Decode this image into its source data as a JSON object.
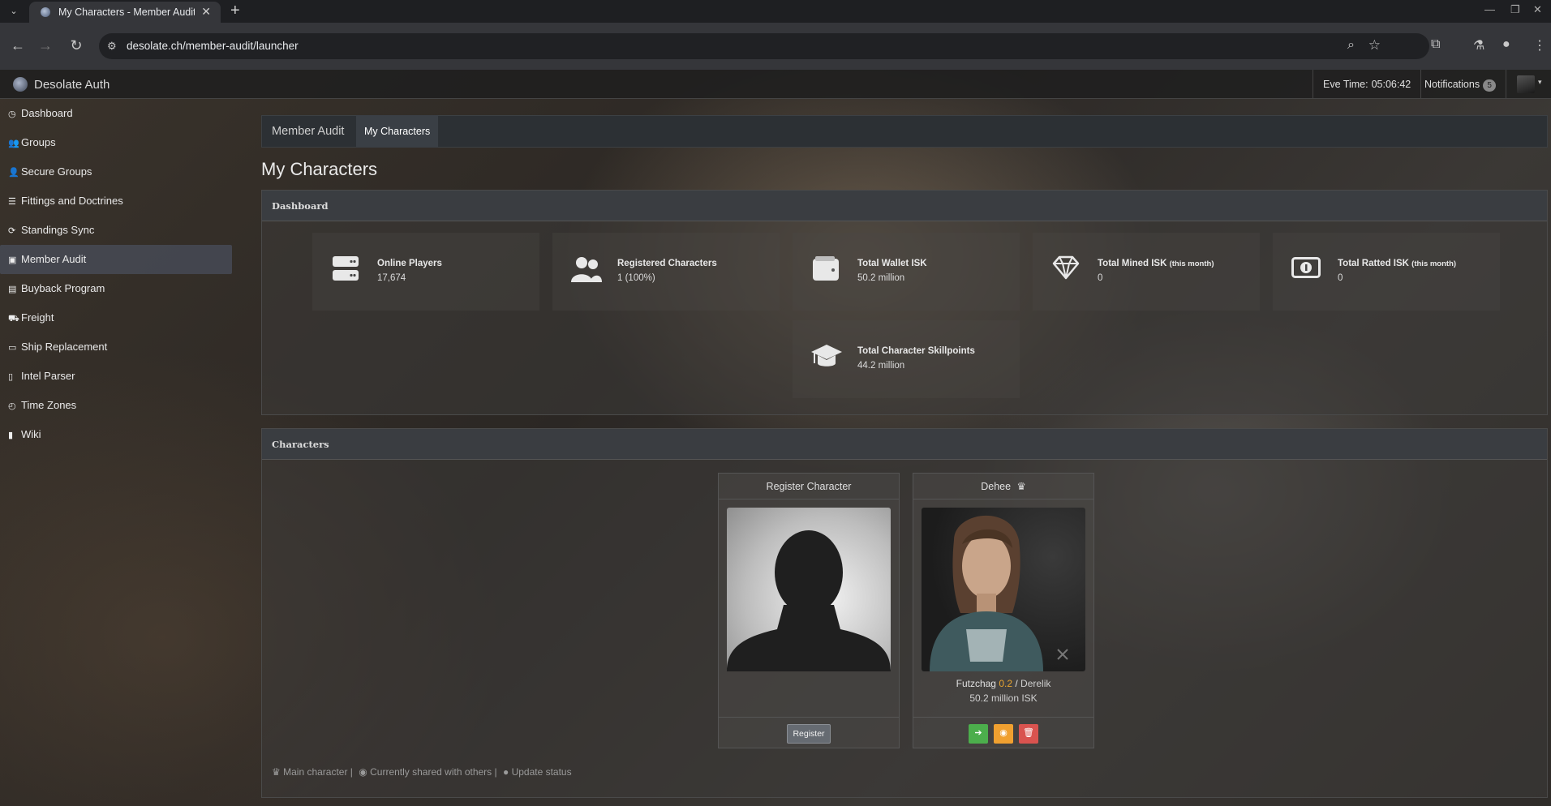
{
  "browser": {
    "tab_title": "My Characters - Member Audit",
    "url": "desolate.ch/member-audit/launcher",
    "icons": [
      "tab-list-icon",
      "favicon",
      "close-icon",
      "plus-icon",
      "back-icon",
      "forward-icon",
      "reload-icon",
      "site-info-icon",
      "zoom-icon",
      "star-icon",
      "extensions-icon",
      "labs-icon",
      "profile-icon",
      "menu-icon",
      "minimize-icon",
      "restore-icon",
      "window-close-icon"
    ]
  },
  "site": {
    "brand": "Desolate Auth",
    "eve_time_label": "Eve Time:",
    "eve_time": "05:06:42",
    "notifications_label": "Notifications",
    "notifications_count": "5"
  },
  "sidebar": {
    "items": [
      {
        "label": "Dashboard",
        "icon": "gauge-icon"
      },
      {
        "label": "Groups",
        "icon": "users-icon"
      },
      {
        "label": "Secure Groups",
        "icon": "user-lock-icon"
      },
      {
        "label": "Fittings and Doctrines",
        "icon": "list-icon"
      },
      {
        "label": "Standings Sync",
        "icon": "sync-icon"
      },
      {
        "label": "Member Audit",
        "icon": "id-card-icon",
        "active": true
      },
      {
        "label": "Buyback Program",
        "icon": "box-icon"
      },
      {
        "label": "Freight",
        "icon": "truck-icon"
      },
      {
        "label": "Ship Replacement",
        "icon": "money-icon"
      },
      {
        "label": "Intel Parser",
        "icon": "file-icon"
      },
      {
        "label": "Time Zones",
        "icon": "clock-icon"
      },
      {
        "label": "Wiki",
        "icon": "book-icon"
      }
    ]
  },
  "subnav": {
    "brand": "Member Audit",
    "active_tab": "My Characters"
  },
  "page_title": "My Characters",
  "dashboard": {
    "title": "Dashboard",
    "stats": [
      {
        "label": "Online Players",
        "suffix": "",
        "value": "17,674",
        "icon": "server-icon"
      },
      {
        "label": "Registered Characters",
        "suffix": "",
        "value": "1 (100%)",
        "icon": "users-icon"
      },
      {
        "label": "Total Wallet ISK",
        "suffix": "",
        "value": "50.2 million",
        "icon": "wallet-icon"
      },
      {
        "label": "Total Mined ISK",
        "suffix": "(this month)",
        "value": "0",
        "icon": "gem-icon"
      },
      {
        "label": "Total Ratted ISK",
        "suffix": "(this month)",
        "value": "0",
        "icon": "money-bill-icon"
      },
      {
        "label": "Total Character Skillpoints",
        "suffix": "",
        "value": "44.2 million",
        "icon": "graduation-cap-icon"
      }
    ]
  },
  "characters": {
    "title": "Characters",
    "register_card": {
      "title": "Register Character",
      "button": "Register"
    },
    "character_card": {
      "name": "Dehee",
      "location": "Futzchag",
      "security": "0.2",
      "separator": "/",
      "region": "Derelik",
      "wallet": "50.2 million ISK"
    },
    "legend": {
      "main": "Main character |",
      "shared": "Currently shared with others |",
      "update": "Update status"
    }
  },
  "colors": {
    "accent_active": "#4d5a6e",
    "security": "#e8a530",
    "btn_green": "#4cae4c",
    "btn_orange": "#f0a030",
    "btn_red": "#d9534f"
  }
}
